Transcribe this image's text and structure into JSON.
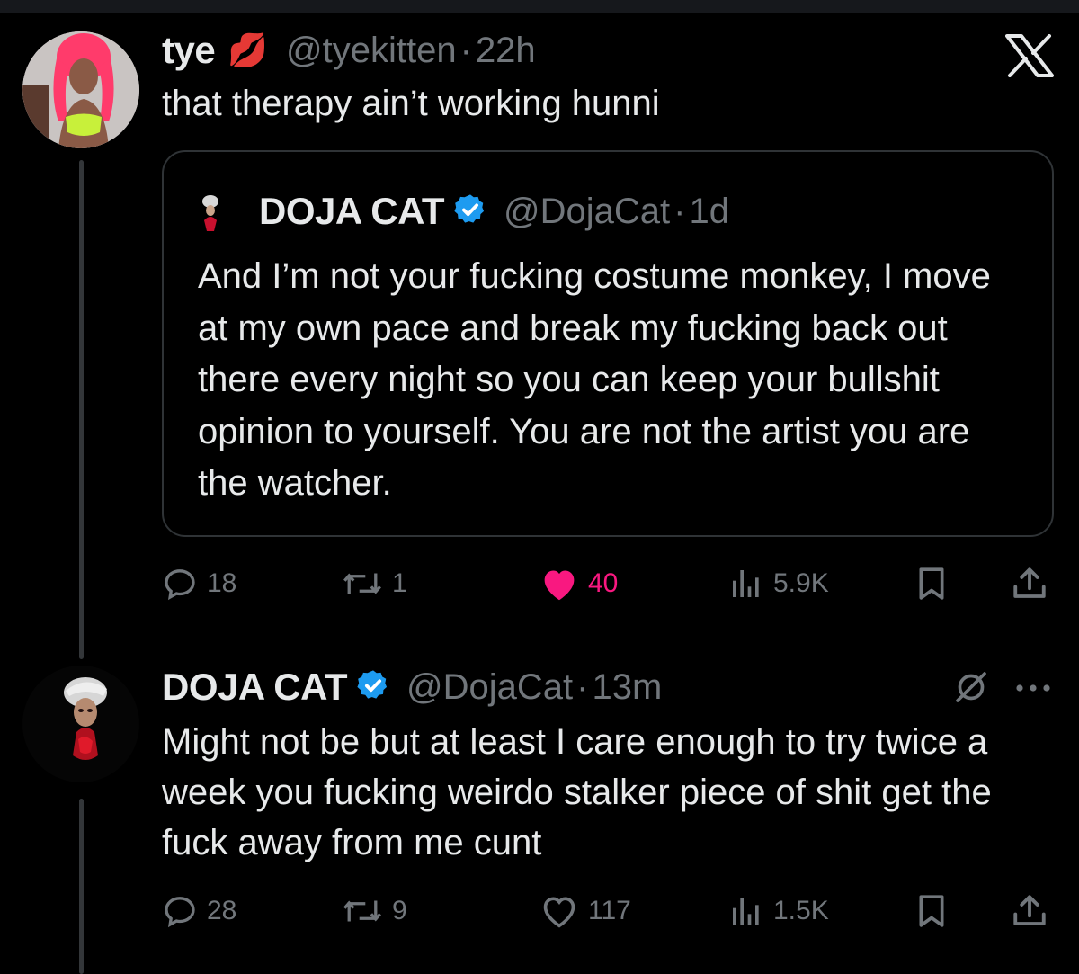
{
  "colors": {
    "background": "#000000",
    "text": "#e7e9ea",
    "muted": "#71767b",
    "like_active": "#f91880",
    "verified": "#1d9bf0",
    "border": "#2f3336"
  },
  "post1": {
    "author_name": "tye",
    "author_emoji": "💋",
    "handle": "@tyekitten",
    "separator": "·",
    "time": "22h",
    "text": "that therapy ain’t working hunni",
    "quote": {
      "author_name": "DOJA CAT",
      "handle": "@DojaCat",
      "separator": "·",
      "time": "1d",
      "text": "And I’m not your fucking costume monkey, I move at my own pace and break my fucking back out there every night so you can keep your bullshit opinion to yourself. You are not the artist you are the watcher."
    },
    "actions": {
      "replies": "18",
      "reposts": "1",
      "likes": "40",
      "views": "5.9K",
      "liked": true
    }
  },
  "post2": {
    "author_name": "DOJA CAT",
    "handle": "@DojaCat",
    "separator": "·",
    "time": "13m",
    "text": "Might not be but at least I care enough to try twice a week you fucking weirdo stalker piece of shit get the fuck away from me cunt",
    "actions": {
      "replies": "28",
      "reposts": "9",
      "likes": "117",
      "views": "1.5K",
      "liked": false
    }
  },
  "icons": {
    "brand": "x-logo-icon",
    "more": "more-icon",
    "grok": "grok-icon",
    "verified": "verified-badge-icon"
  }
}
